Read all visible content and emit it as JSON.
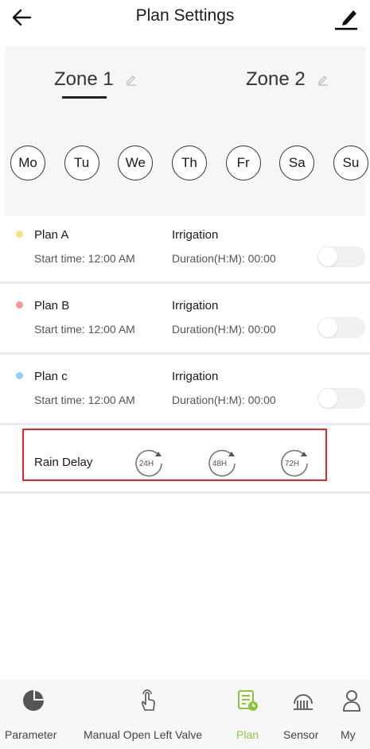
{
  "header": {
    "title": "Plan Settings",
    "back_icon": "arrow-left-icon",
    "edit_icon": "pencil-icon"
  },
  "zones": [
    {
      "label": "Zone 1",
      "selected": true
    },
    {
      "label": "Zone 2",
      "selected": false
    }
  ],
  "days": [
    "Mo",
    "Tu",
    "We",
    "Th",
    "Fr",
    "Sa",
    "Su"
  ],
  "plans": [
    {
      "name": "Plan A",
      "dot_color": "#f9e07a",
      "start": "Start time: 12:00 AM",
      "type": "Irrigation",
      "duration": "Duration(H:M): 00:00",
      "enabled": false
    },
    {
      "name": "Plan B",
      "dot_color": "#f3999d",
      "start": "Start time: 12:00 AM",
      "type": "Irrigation",
      "duration": "Duration(H:M): 00:00",
      "enabled": false
    },
    {
      "name": "Plan c",
      "dot_color": "#8fd3f0",
      "start": "Start time: 12:00 AM",
      "type": "Irrigation",
      "duration": "Duration(H:M): 00:00",
      "enabled": false
    }
  ],
  "rain_delay": {
    "label": "Rain Delay",
    "options": [
      "24H",
      "48H",
      "72H"
    ],
    "highlight_color": "#e0262b"
  },
  "nav": {
    "active_color": "#8cc63f",
    "items": [
      {
        "label": "Parameter",
        "icon": "pie-chart-icon",
        "active": false
      },
      {
        "label": "Manual Open Left Valve",
        "icon": "hand-tap-icon",
        "active": false
      },
      {
        "label": "Plan",
        "icon": "plan-document-icon",
        "active": true
      },
      {
        "label": "Sensor",
        "icon": "sensor-icon",
        "active": false
      },
      {
        "label": "My",
        "icon": "person-icon",
        "active": false
      }
    ]
  }
}
